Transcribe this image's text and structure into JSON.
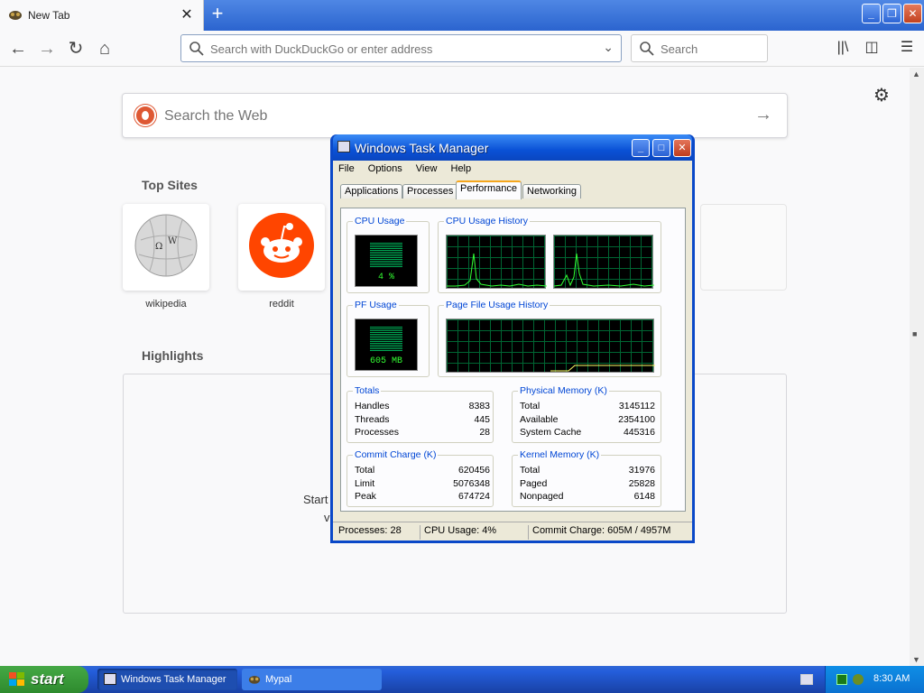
{
  "browser": {
    "tab_title": "New Tab",
    "tab_close": "✕",
    "new_tab": "+",
    "window_controls": {
      "minimize": "_",
      "maximize": "❐",
      "close": "✕"
    },
    "url_placeholder": "Search with DuckDuckGo or enter address",
    "search_placeholder": "Search",
    "icons": [
      "back-icon",
      "forward-icon",
      "reload-icon",
      "home-icon",
      "library-icon",
      "sidebar-icon",
      "menu-icon"
    ]
  },
  "newtab": {
    "search_placeholder": "Search the Web",
    "top_sites_title": "Top Sites",
    "highlights_title": "Highlights",
    "top_sites": [
      {
        "label": "wikipedia"
      },
      {
        "label": "reddit"
      }
    ],
    "highlights_text_1": "Start",
    "highlights_text_2": "vi"
  },
  "taskmanager": {
    "title": "Windows Task Manager",
    "menu": [
      "File",
      "Options",
      "View",
      "Help"
    ],
    "tabs": [
      "Applications",
      "Processes",
      "Performance",
      "Networking"
    ],
    "active_tab": "Performance",
    "cpu_usage_label": "CPU Usage",
    "cpu_usage_value": "4 %",
    "cpu_history_label": "CPU Usage History",
    "pf_usage_label": "PF Usage",
    "pf_usage_value": "605 MB",
    "pf_history_label": "Page File Usage History",
    "totals": {
      "label": "Totals",
      "rows": [
        [
          "Handles",
          "8383"
        ],
        [
          "Threads",
          "445"
        ],
        [
          "Processes",
          "28"
        ]
      ]
    },
    "physical": {
      "label": "Physical Memory (K)",
      "rows": [
        [
          "Total",
          "3145112"
        ],
        [
          "Available",
          "2354100"
        ],
        [
          "System Cache",
          "445316"
        ]
      ]
    },
    "commit": {
      "label": "Commit Charge (K)",
      "rows": [
        [
          "Total",
          "620456"
        ],
        [
          "Limit",
          "5076348"
        ],
        [
          "Peak",
          "674724"
        ]
      ]
    },
    "kernel": {
      "label": "Kernel Memory (K)",
      "rows": [
        [
          "Total",
          "31976"
        ],
        [
          "Paged",
          "25828"
        ],
        [
          "Nonpaged",
          "6148"
        ]
      ]
    },
    "status": [
      "Processes: 28",
      "CPU Usage: 4%",
      "Commit Charge: 605M / 4957M"
    ]
  },
  "taskbar": {
    "start_label": "start",
    "tasks": [
      "Windows Task Manager",
      "Mypal"
    ],
    "clock": "8:30 AM"
  },
  "colors": {
    "xp_blue": "#0a48c8",
    "graph_green": "#33ff33",
    "start_green": "#3a9a3a"
  }
}
